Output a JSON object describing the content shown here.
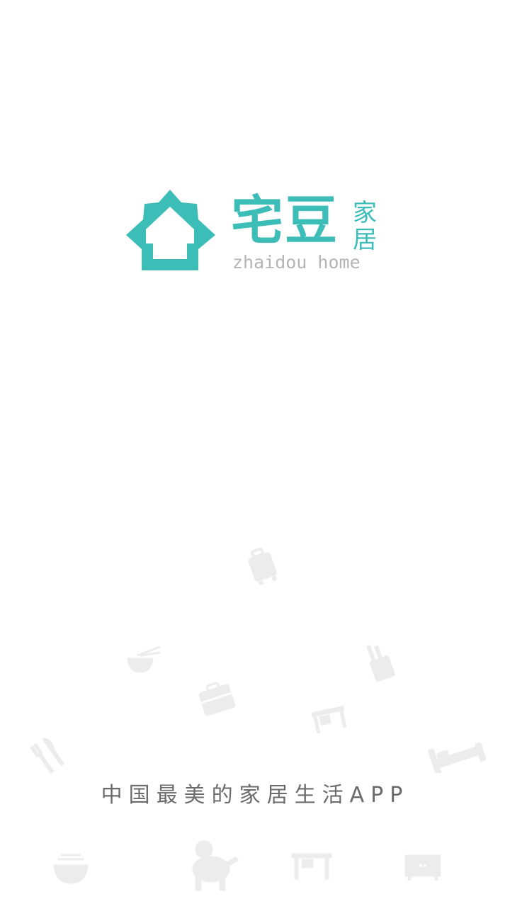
{
  "splash": {
    "logo": {
      "main_text": "宅豆",
      "side_text_top": "家",
      "side_text_bottom": "居",
      "english_text": "zhaidou home",
      "brand_color": "#3dbdb8"
    },
    "slogan": "中国最美的家居生活APP",
    "decorative_icons": [
      "suitcase-icon",
      "noodle-bowl-icon",
      "kitchen-utensils-icon",
      "luggage-icon",
      "desk-icon",
      "fork-knife-icon",
      "bed-icon",
      "bowl-icon",
      "dog-icon",
      "table-icon",
      "cabinet-icon"
    ],
    "icon_color": "#ececec"
  }
}
